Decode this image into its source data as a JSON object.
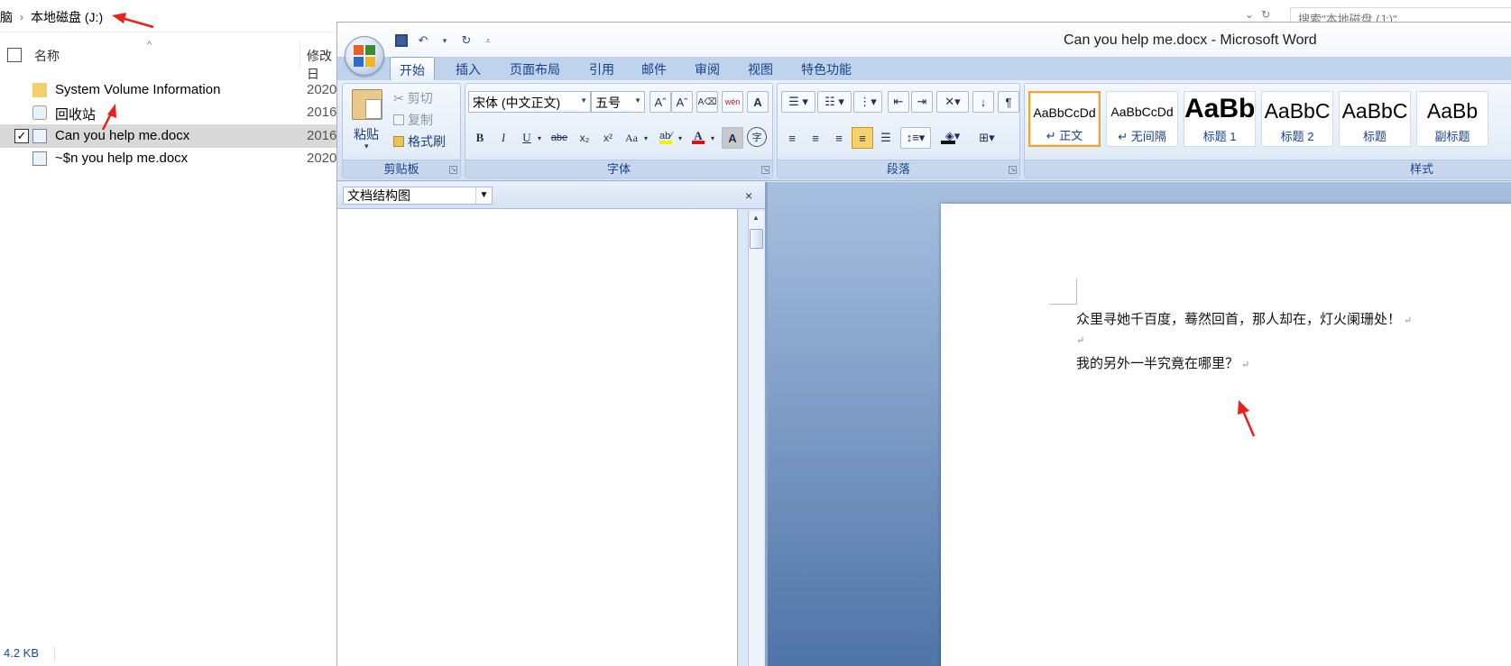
{
  "explorer": {
    "breadcrumb": [
      "电脑",
      "本地磁盘 (J:)"
    ],
    "search_placeholder": "搜索\"本地磁盘 (J:)\"",
    "columns": {
      "name": "名称",
      "modified": "修改日"
    },
    "rows": [
      {
        "name": "System Volume Information",
        "date": "2020",
        "icon": "folder-icon",
        "selected": false
      },
      {
        "name": "回收站",
        "date": "2016",
        "icon": "recycle-bin-icon",
        "selected": false
      },
      {
        "name": "Can you help me.docx",
        "date": "2016",
        "icon": "word-doc-icon",
        "selected": true
      },
      {
        "name": "~$n you help me.docx",
        "date": "2020",
        "icon": "word-doc-icon",
        "selected": false
      }
    ],
    "status": "4.2 KB"
  },
  "word": {
    "title": "Can you help me.docx - Microsoft Word",
    "tabs": [
      "开始",
      "插入",
      "页面布局",
      "引用",
      "邮件",
      "审阅",
      "视图",
      "特色功能"
    ],
    "active_tab": "开始",
    "clipboard": {
      "label": "剪贴板",
      "paste": "粘贴",
      "cut": "剪切",
      "copy": "复制",
      "format_painter": "格式刷"
    },
    "font": {
      "label": "字体",
      "font_name": "宋体 (中文正文)",
      "font_size": "五号",
      "grow": "Aˆ",
      "shrink": "Aˇ",
      "phonetic": "wén",
      "bold": "B",
      "italic": "I",
      "underline": "U",
      "strike": "abe",
      "subscript": "x₂",
      "superscript": "x²",
      "change_case": "Aa",
      "highlight": "ab⁄",
      "font_color": "A",
      "char_shading": "A",
      "enclose": "字",
      "highlight_color": "#f5f100",
      "font_color_value": "#e01010"
    },
    "paragraph": {
      "label": "段落"
    },
    "styles": {
      "label": "样式",
      "items": [
        {
          "sample": "AaBbCcDd",
          "name": "↵ 正文"
        },
        {
          "sample": "AaBbCcDd",
          "name": "↵ 无间隔"
        },
        {
          "sample": "AaBb",
          "name": "标题 1"
        },
        {
          "sample": "AaBbC",
          "name": "标题 2"
        },
        {
          "sample": "AaBbC",
          "name": "标题"
        },
        {
          "sample": "AaBb",
          "name": "副标题"
        }
      ]
    },
    "nav_pane": {
      "mode": "文档结构图",
      "close": "×"
    },
    "document": {
      "paragraphs": [
        "众里寻她千百度，蓦然回首，那人却在，灯火阑珊处！",
        "",
        "我的另外一半究竟在哪里？"
      ],
      "paragraph_mark": "↵"
    }
  },
  "annotation_color": "#e8221b"
}
